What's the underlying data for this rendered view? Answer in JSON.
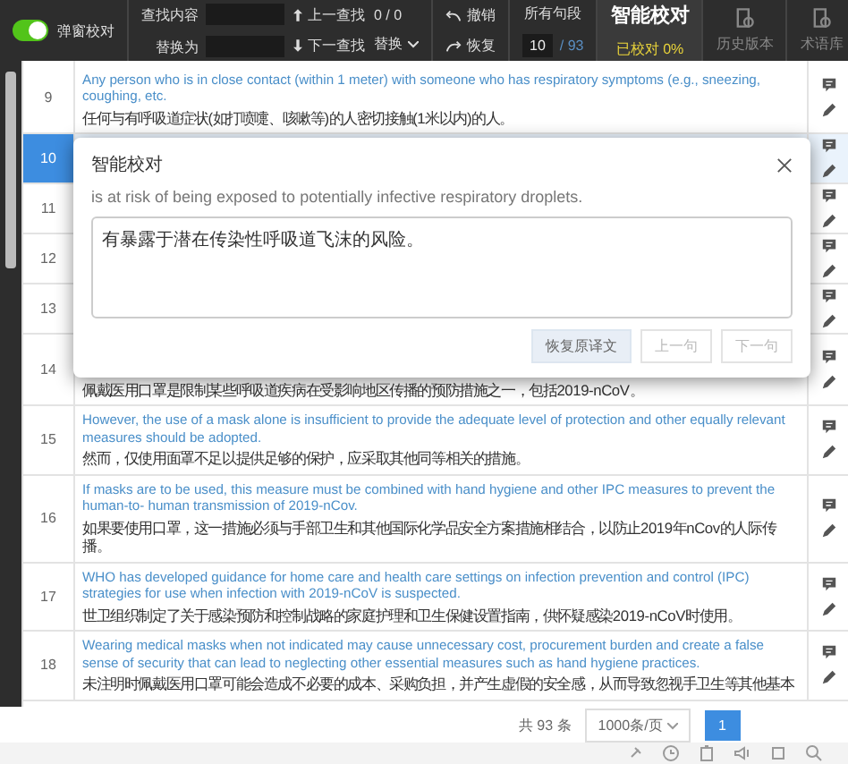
{
  "toolbar": {
    "popup_toggle": {
      "label": "弹窗校对",
      "on": true
    },
    "find": {
      "label": "查找内容"
    },
    "replace": {
      "label": "替换为"
    },
    "prev_find": "上一查找",
    "next_find": "下一查找",
    "find_count": "0 / 0",
    "replace_menu": "替换",
    "undo": "撤销",
    "redo": "恢复",
    "segments": {
      "label": "所有句段",
      "current": "10",
      "total": "/ 93"
    },
    "proofread": {
      "title": "智能校对",
      "progress": "已校对 0%"
    },
    "history": "历史版本",
    "terms": "术语库"
  },
  "rows": [
    {
      "number": "9",
      "selected": false,
      "en": "Any person who is in close contact (within 1 meter) with someone who has respiratory symptoms (e.g., sneezing, coughing, etc.",
      "zh": "任何与有呼吸道症状(如打喷嚏、咳嗽等)的人密切接触(1米以内)的人。"
    },
    {
      "number": "10",
      "selected": true
    },
    {
      "number": "11",
      "selected": false
    },
    {
      "number": "12",
      "selected": false
    },
    {
      "number": "13",
      "selected": false
    },
    {
      "number": "14",
      "selected": false,
      "zh": "佩戴医用口罩是限制某些呼吸道疾病在受影响地区传播的预防措施之一，包括2019-nCoV。"
    },
    {
      "number": "15",
      "selected": false,
      "en": "However, the use of a mask alone is insufficient to provide the adequate level of protection and other equally relevant measures should be adopted.",
      "zh": "然而，仅使用面罩不足以提供足够的保护，应采取其他同等相关的措施。"
    },
    {
      "number": "16",
      "selected": false,
      "en": "If masks are to be used, this measure must be combined with hand hygiene and other IPC measures to prevent the human-to- human transmission of 2019-nCov.",
      "zh": "如果要使用口罩，这一措施必须与手部卫生和其他国际化学品安全方案措施相结合，以防止2019年nCov的人际传播。"
    },
    {
      "number": "17",
      "selected": false,
      "en": "WHO has developed guidance for home care and health care settings on infection prevention and control (IPC) strategies for use when infection with 2019-nCoV is suspected.",
      "zh": "世卫组织制定了关于感染预防和控制战略的家庭护理和卫生保健设置指南，供怀疑感染2019-nCoV时使用。"
    },
    {
      "number": "18",
      "selected": false,
      "en": "Wearing medical masks when not indicated may cause unnecessary cost, procurement burden and create a false sense of security that can lead to neglecting other essential measures such as hand hygiene practices.",
      "zh": "未注明时佩戴医用口罩可能会造成不必要的成本、采购负担，并产生虚假的安全感，从而导致忽视手卫生等其他基本"
    }
  ],
  "dialog": {
    "title": "智能校对",
    "source": "is at risk of being exposed to potentially infective respiratory droplets.",
    "translation": "有暴露于潜在传染性呼吸道飞沫的风险。",
    "buttons": [
      {
        "label": "恢复原译文",
        "disabled": false
      },
      {
        "label": "上一句",
        "disabled": true
      },
      {
        "label": "下一句",
        "disabled": true
      }
    ]
  },
  "pagination": {
    "total": "共 93 条",
    "page_size": "1000条/页",
    "pages": [
      {
        "label": "1",
        "selected": true
      }
    ]
  }
}
